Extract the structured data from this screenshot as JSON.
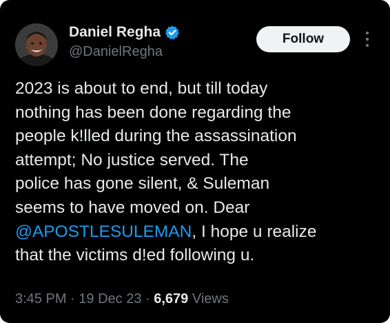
{
  "author": {
    "display_name": "Daniel Regha",
    "handle": "@DanielRegha",
    "verified": true,
    "avatar_icon": "profile-photo"
  },
  "actions": {
    "follow_label": "Follow",
    "more_icon": "more-vertical-icon"
  },
  "tweet": {
    "lines": [
      "2023 is about to end, but till today",
      "nothing has been done regarding the",
      "people k!lled during the assassination",
      "attempt; No justice served. The",
      "police has gone silent, & Suleman",
      "seems to have moved on. Dear"
    ],
    "mention": "@APOSTLESULEMAN",
    "line7_after_mention": ", I hope u realize",
    "line8": "that the victims d!ed following u."
  },
  "meta": {
    "time": "3:45 PM",
    "sep1": " · ",
    "date": "19 Dec 23",
    "sep2": " · ",
    "views_count": "6,679",
    "views_label": " Views"
  },
  "colors": {
    "background": "#000000",
    "text": "#e7e9ea",
    "muted": "#71767b",
    "link": "#1d9bf0",
    "verified": "#1d9bf0",
    "follow_bg": "#eff3f4"
  }
}
